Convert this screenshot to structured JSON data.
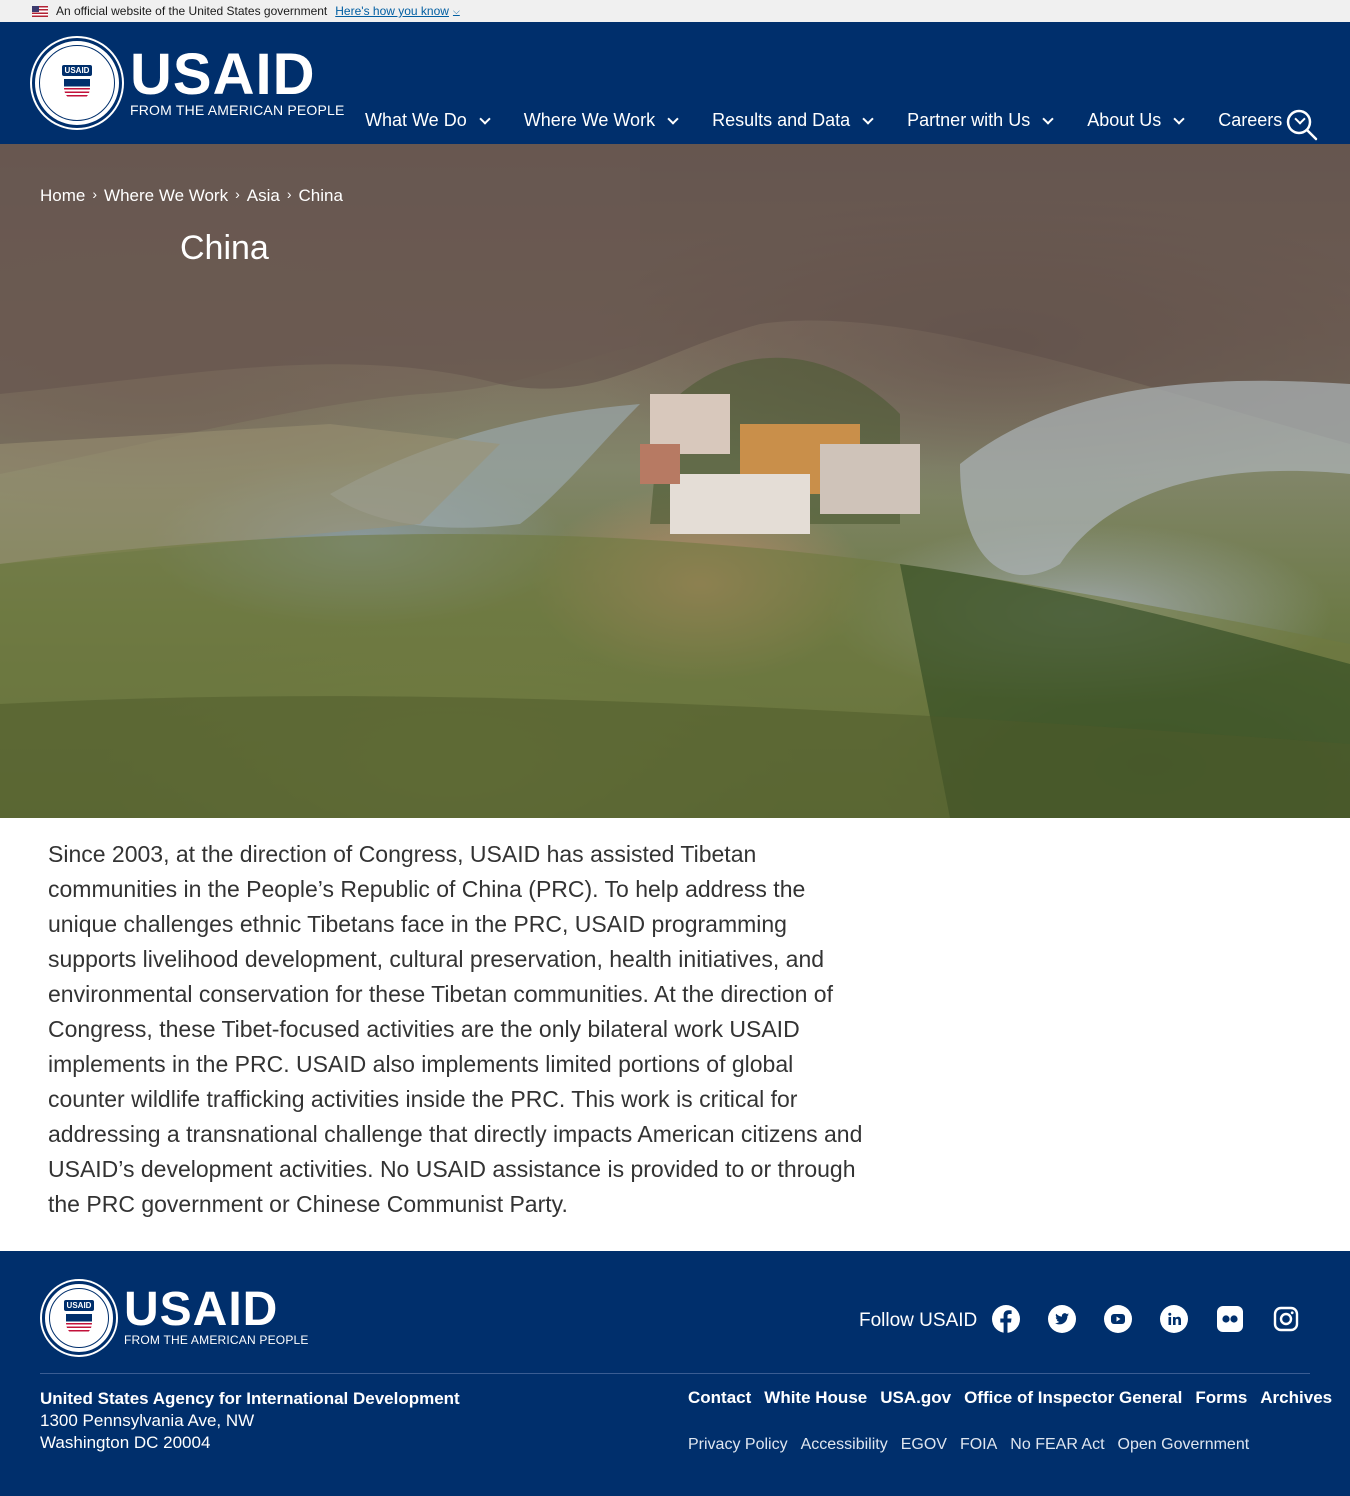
{
  "gov_banner": {
    "text": "An official website of the United States government",
    "link": "Here's how you know"
  },
  "header": {
    "logo": {
      "seal_tag": "USAID",
      "name": "USAID",
      "tagline": "FROM THE AMERICAN PEOPLE"
    },
    "nav": [
      {
        "label": "What We Do"
      },
      {
        "label": "Where We Work"
      },
      {
        "label": "Results and Data"
      },
      {
        "label": "Partner with Us"
      },
      {
        "label": "About Us"
      },
      {
        "label": "Careers"
      }
    ]
  },
  "hero": {
    "breadcrumb": [
      "Home",
      "Where We Work",
      "Asia",
      "China"
    ],
    "title": "China"
  },
  "main": {
    "intro": "Since 2003, at the direction of Congress, USAID has assisted Tibetan communities in the People’s Republic of China (PRC). To help address the unique challenges ethnic Tibetans face in the PRC, USAID programming supports livelihood development, cultural preservation, health initiatives, and environmental conservation for these Tibetan communities. At the direction of Congress, these Tibet-focused activities are the only bilateral work USAID implements in the PRC. USAID also implements limited portions of global counter wildlife trafficking activities inside the PRC. This work is critical for addressing a transnational challenge that directly impacts American citizens and USAID’s development activities. No USAID assistance is provided to or through the PRC government or Chinese Communist Party."
  },
  "footer": {
    "logo": {
      "seal_tag": "USAID",
      "name": "USAID",
      "tagline": "FROM THE AMERICAN PEOPLE"
    },
    "follow_label": "Follow USAID",
    "socials": [
      "facebook-icon",
      "twitter-icon",
      "youtube-icon",
      "linkedin-icon",
      "flickr-icon",
      "instagram-icon"
    ],
    "org_name": "United States Agency for International Development",
    "address_line1": "1300 Pennsylvania Ave, NW",
    "address_line2": "Washington DC 20004",
    "primary_links": [
      "Contact",
      "White House",
      "USA.gov",
      "Office of Inspector General",
      "Forms",
      "Archives"
    ],
    "secondary_links": [
      "Privacy Policy",
      "Accessibility",
      "EGOV",
      "FOIA",
      "No FEAR Act",
      "Open Government"
    ]
  },
  "colors": {
    "navy": "#002f6c",
    "banner_bg": "#f0f0f0",
    "link_blue": "#005ea2"
  }
}
